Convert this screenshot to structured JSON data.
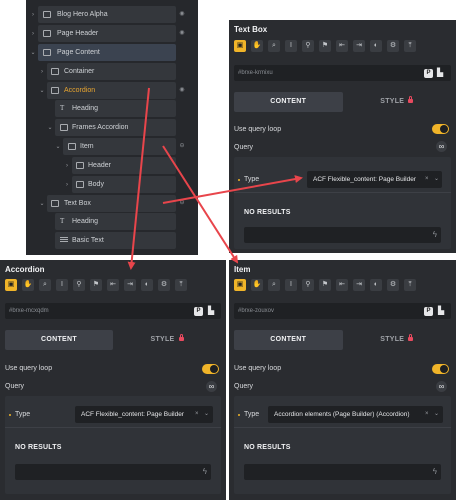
{
  "tree": {
    "rows": [
      {
        "label": "Blog Hero Alpha"
      },
      {
        "label": "Page Header"
      },
      {
        "label": "Page Content"
      },
      {
        "label": "Container"
      },
      {
        "label": "Accordion"
      },
      {
        "label": "Heading"
      },
      {
        "label": "Frames Accordion"
      },
      {
        "label": "Item"
      },
      {
        "label": "Header"
      },
      {
        "label": "Body"
      },
      {
        "label": "Text Box"
      },
      {
        "label": "Heading"
      },
      {
        "label": "Basic Text"
      }
    ]
  },
  "panels": {
    "textbox": {
      "title": "Text Box",
      "id_value": "#brxe-krmixu",
      "tab_content": "CONTENT",
      "tab_style": "STYLE",
      "use_query_loop": "Use query loop",
      "query": "Query",
      "type_label": "Type",
      "type_value": "ACF Flexible_content: Page Builder",
      "no_results": "NO RESULTS"
    },
    "accordion": {
      "title": "Accordion",
      "id_value": "#brxe-mcxqdm",
      "tab_content": "CONTENT",
      "tab_style": "STYLE",
      "use_query_loop": "Use query loop",
      "query": "Query",
      "type_label": "Type",
      "type_value": "ACF Flexible_content: Page Builder",
      "no_results": "NO RESULTS"
    },
    "item": {
      "title": "Item",
      "id_value": "#brxe-zouxov",
      "tab_content": "CONTENT",
      "tab_style": "STYLE",
      "use_query_loop": "Use query loop",
      "query": "Query",
      "type_label": "Type",
      "type_value": "Accordion elements (Page Builder) (Accordion)",
      "no_results": "NO RESULTS"
    }
  },
  "glyphs": {
    "chev_right": "›",
    "chev_down": "⌄",
    "clear": "×",
    "dropdown": "⌄",
    "infinity": "∞",
    "bolt": "ϟ",
    "p_badge": "P",
    "file": "▙",
    "t_icon": "T",
    "eye": "◉",
    "link": "⊖"
  },
  "colors": {
    "accent": "#f0b429",
    "arrow": "#e8454b",
    "active_row_label": "#e8a530"
  }
}
